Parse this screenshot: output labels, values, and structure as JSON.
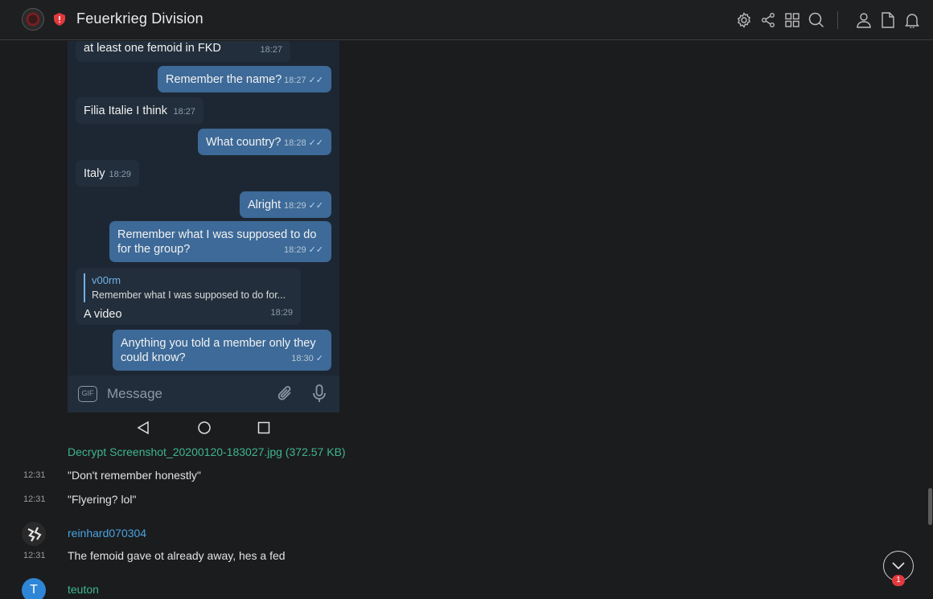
{
  "header": {
    "title": "Feuerkrieg Division",
    "icons": [
      "settings-icon",
      "share-icon",
      "grid-icon",
      "search-icon",
      "user-icon",
      "file-icon",
      "bell-icon"
    ]
  },
  "phone": {
    "messages": [
      {
        "dir": "in",
        "text": "at least one femoid in FKD",
        "time": "18:27"
      },
      {
        "dir": "out",
        "text": "Remember the name?",
        "time": "18:27",
        "check": "✓✓"
      },
      {
        "dir": "in",
        "text": "Filia Italie I think",
        "time": "18:27"
      },
      {
        "dir": "out",
        "text": "What country?",
        "time": "18:28",
        "check": "✓✓"
      },
      {
        "dir": "in",
        "text": "Italy",
        "time": "18:29"
      },
      {
        "dir": "out",
        "text": "Alright",
        "time": "18:29",
        "check": "✓✓"
      },
      {
        "dir": "out",
        "text": "Remember what I was supposed to do for the group?",
        "time": "18:29",
        "check": "✓✓"
      },
      {
        "dir": "in",
        "reply_name": "v00rm",
        "reply_text": "Remember what I was supposed to do for...",
        "text": "A video",
        "time": "18:29"
      },
      {
        "dir": "out",
        "text": "Anything you told a member only they could know?",
        "time": "18:30",
        "check": "✓"
      }
    ],
    "input_placeholder": "Message",
    "gif_label": "GIF"
  },
  "chat": {
    "attachment_link": "Decrypt Screenshot_20200120-183027.jpg (372.57 KB)",
    "lines": [
      {
        "time": "12:31",
        "text": "\"Don't remember honestly\""
      },
      {
        "time": "12:31",
        "text": "\"Flyering? lol\""
      }
    ],
    "user1": {
      "name": "reinhard070304",
      "time": "12:31",
      "text": "The femoid gave ot already away, hes a fed",
      "color": "#4aa3df"
    },
    "user2": {
      "name": "teuton",
      "initial": "T",
      "color": "#3fb58f",
      "avatar_color": "#2f86d6"
    }
  },
  "unread_count": "1"
}
